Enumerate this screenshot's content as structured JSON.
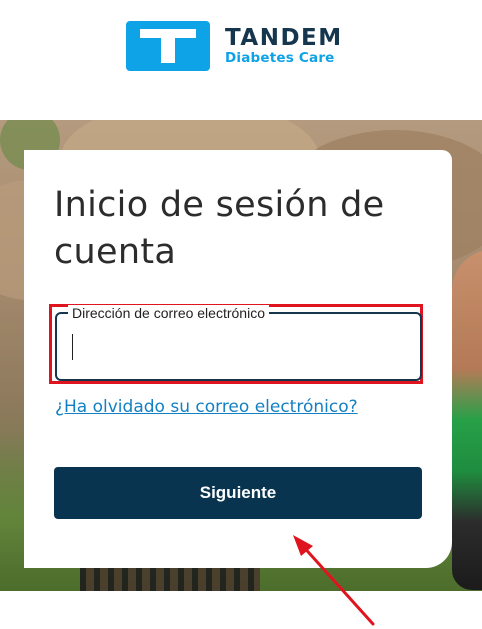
{
  "header": {
    "logo_name": "TANDEM",
    "logo_subtitle": "Diabetes Care",
    "logo_icon": "tandem-t-logo-icon",
    "brand_color": "#0ea2e6",
    "text_color": "#16364d"
  },
  "login_card": {
    "title": "Inicio de sesión de cuenta",
    "email_field": {
      "label": "Dirección de correo electrónico",
      "value": ""
    },
    "forgot_email_link": "¿Ha olvidado su correo electrónico?",
    "next_button": "Siguiente",
    "button_color": "#08344f",
    "link_color": "#1380c4"
  },
  "annotation": {
    "highlight_color": "#e0141e",
    "arrow_icon": "red-arrow-icon"
  }
}
